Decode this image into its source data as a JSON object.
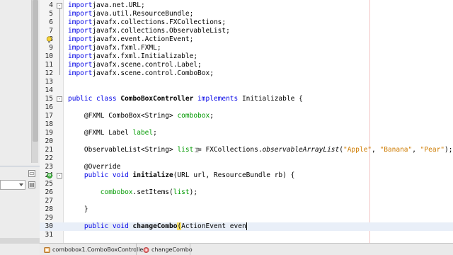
{
  "editor": {
    "lines": [
      {
        "n": "4",
        "tokens": [
          [
            "kw",
            "import"
          ],
          [
            "",
            "java.net.URL;"
          ]
        ],
        "fold": "-"
      },
      {
        "n": "5",
        "tokens": [
          [
            "kw",
            "import"
          ],
          [
            "",
            "java.util.ResourceBundle;"
          ]
        ]
      },
      {
        "n": "6",
        "tokens": [
          [
            "kw",
            "import"
          ],
          [
            "",
            "javafx.collections.FXCollections;"
          ]
        ]
      },
      {
        "n": "7",
        "tokens": [
          [
            "kw",
            "import"
          ],
          [
            "",
            "javafx.collections.ObservableList;"
          ]
        ]
      },
      {
        "n": "8",
        "tokens": [
          [
            "kw",
            "import"
          ],
          [
            "",
            "javafx.event.ActionEvent;"
          ]
        ],
        "marker": "hint-bulb"
      },
      {
        "n": "9",
        "tokens": [
          [
            "kw",
            "import"
          ],
          [
            "",
            "javafx.fxml.FXML;"
          ]
        ]
      },
      {
        "n": "10",
        "tokens": [
          [
            "kw",
            "import"
          ],
          [
            "",
            "javafx.fxml.Initializable;"
          ]
        ]
      },
      {
        "n": "11",
        "tokens": [
          [
            "kw",
            "import"
          ],
          [
            "",
            "javafx.scene.control.Label;"
          ]
        ]
      },
      {
        "n": "12",
        "tokens": [
          [
            "kw",
            "import"
          ],
          [
            "",
            "javafx.scene.control.ComboBox;"
          ]
        ]
      },
      {
        "n": "13",
        "tokens": []
      },
      {
        "n": "14",
        "tokens": []
      },
      {
        "n": "15",
        "tokens": [
          [
            "kw",
            "public class "
          ],
          [
            "cls",
            "ComboBoxController"
          ],
          [
            "kw",
            " implements"
          ],
          [
            "",
            " Initializable {"
          ]
        ],
        "fold": "-"
      },
      {
        "n": "16",
        "tokens": []
      },
      {
        "n": "17",
        "tokens": [
          [
            "",
            "    @FXML ComboBox<String> "
          ],
          [
            "fld",
            "combobox"
          ],
          [
            "",
            ";"
          ]
        ]
      },
      {
        "n": "18",
        "tokens": []
      },
      {
        "n": "19",
        "tokens": [
          [
            "",
            "    @FXML Label "
          ],
          [
            "fld",
            "label"
          ],
          [
            "",
            ";"
          ]
        ]
      },
      {
        "n": "20",
        "tokens": []
      },
      {
        "n": "21",
        "tokens": [
          [
            "",
            "    ObservableList<String> "
          ],
          [
            "fld",
            "list"
          ],
          [
            "",
            " = FXCollections."
          ],
          [
            "ital",
            "observableArrayList"
          ],
          [
            "",
            "("
          ],
          [
            "str",
            "\"Apple\""
          ],
          [
            "",
            ", "
          ],
          [
            "str",
            "\"Banana\""
          ],
          [
            "",
            ", "
          ],
          [
            "str",
            "\"Pear\""
          ],
          [
            "",
            ");"
          ]
        ]
      },
      {
        "n": "22",
        "tokens": []
      },
      {
        "n": "23",
        "tokens": [
          [
            "",
            "    @Override"
          ]
        ]
      },
      {
        "n": "24",
        "tokens": [
          [
            "kw",
            "    public void "
          ],
          [
            "cls",
            "initialize"
          ],
          [
            "",
            "(URL url, ResourceBundle rb) {"
          ]
        ],
        "marker": "override",
        "fold": "-"
      },
      {
        "n": "25",
        "tokens": []
      },
      {
        "n": "26",
        "tokens": [
          [
            "",
            "        "
          ],
          [
            "fld",
            "combobox"
          ],
          [
            "",
            ".setItems("
          ],
          [
            "fld",
            "list"
          ],
          [
            "",
            ");"
          ]
        ]
      },
      {
        "n": "27",
        "tokens": []
      },
      {
        "n": "28",
        "tokens": [
          [
            "",
            "    }"
          ]
        ]
      },
      {
        "n": "29",
        "tokens": []
      },
      {
        "n": "30",
        "tokens": [
          [
            "kw",
            "    public void "
          ],
          [
            "cls",
            "changeCombo"
          ],
          [
            "hl",
            "("
          ],
          [
            "",
            "ActionEvent even"
          ]
        ],
        "current": true,
        "caret": true
      },
      {
        "n": "31",
        "tokens": []
      }
    ]
  },
  "navbar": {
    "crumbs": [
      {
        "label": "combobox1.ComboBoxController",
        "icon": "class-icon"
      },
      {
        "label": "changeCombo",
        "icon": "method-icon"
      }
    ]
  }
}
